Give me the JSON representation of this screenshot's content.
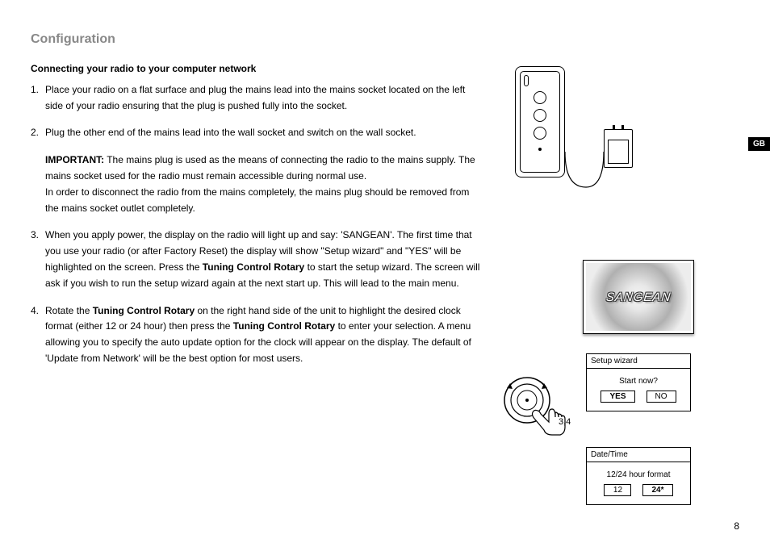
{
  "page": {
    "heading": "Configuration",
    "sub_heading": "Connecting your radio to your computer network",
    "page_number": "8",
    "lang_tab": "GB"
  },
  "steps": {
    "s1": {
      "num": "1.",
      "text": "Place your radio on a flat surface and plug the mains lead into the mains socket located on the left side of your radio ensuring that the plug is pushed fully into the socket."
    },
    "s2": {
      "num": "2.",
      "text": "Plug the other end of the mains lead into the wall socket and switch on the wall socket."
    },
    "important": {
      "label": "IMPORTANT:",
      "text": " The mains plug is used as the means of connecting the radio to the mains supply. The mains socket used for the radio must remain accessible during normal use.",
      "text2": "In order to disconnect the radio from the mains completely, the mains plug should be removed from the mains socket outlet completely."
    },
    "s3": {
      "num": "3.",
      "pre": "When you apply power, the display on the radio will light up and say: 'SANGEAN'. The first time that you use your radio (or after Factory Reset) the display will show \"Setup wizard\" and \"YES\" will be highlighted on the screen. Press the ",
      "bold1": "Tuning Control Rotary",
      "post": " to start the setup wizard. The screen will ask if you wish to run the setup wizard again at the next start up. This will lead to the main menu."
    },
    "s4": {
      "num": "4.",
      "pre": "Rotate the ",
      "bold1": "Tuning Control Rotary",
      "mid": " on the right hand side of the unit to highlight the desired clock format (either 12 or 24 hour) then press the ",
      "bold2": "Tuning Control Rotary",
      "post": " to enter your selection. A menu allowing you to specify the auto update option for the clock will appear on the display. The default of 'Update from Network' will be the best option for most users."
    }
  },
  "figures": {
    "sangean_logo": "SANGEAN",
    "rotary_label": "3,4"
  },
  "wizard": {
    "title": "Setup wizard",
    "prompt": "Start now?",
    "opt_yes": "YES",
    "opt_no": "NO"
  },
  "datetime": {
    "title": "Date/Time",
    "prompt": "12/24 hour format",
    "opt_12": "12",
    "opt_24": "24*"
  }
}
